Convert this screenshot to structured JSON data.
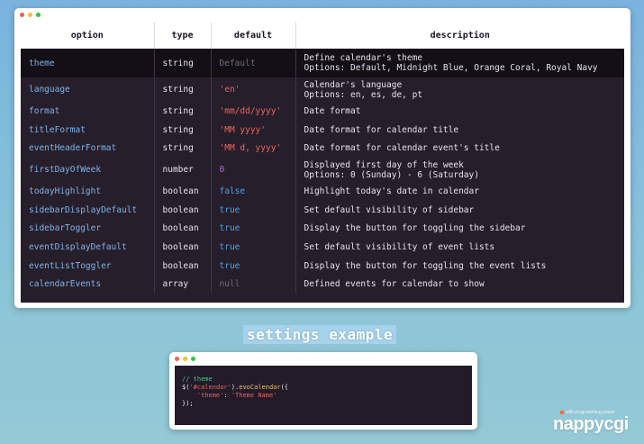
{
  "options_table": {
    "headers": [
      "option",
      "type",
      "default",
      "description"
    ],
    "rows": [
      {
        "option": "theme",
        "type": "string",
        "default": "Default",
        "default_kind": "default",
        "description": [
          "Define calendar's theme",
          "Options: Default, Midnight Blue, Orange Coral, Royal Navy"
        ]
      },
      {
        "option": "language",
        "type": "string",
        "default": "'en'",
        "default_kind": "string",
        "description": [
          "Calendar's language",
          "Options: en, es, de, pt"
        ]
      },
      {
        "option": "format",
        "type": "string",
        "default": "'mm/dd/yyyy'",
        "default_kind": "string",
        "description": [
          "Date format"
        ]
      },
      {
        "option": "titleFormat",
        "type": "string",
        "default": "'MM yyyy'",
        "default_kind": "string",
        "description": [
          "Date format for calendar title"
        ]
      },
      {
        "option": "eventHeaderFormat",
        "type": "string",
        "default": "'MM d, yyyy'",
        "default_kind": "string",
        "description": [
          "Date format for calendar event's title"
        ]
      },
      {
        "option": "firstDayOfWeek",
        "type": "number",
        "default": "0",
        "default_kind": "number",
        "description": [
          "Displayed first day of the week",
          "Options: 0 (Sunday) - 6 (Saturday)"
        ]
      },
      {
        "option": "todayHighlight",
        "type": "boolean",
        "default": "false",
        "default_kind": "bool",
        "description": [
          "Highlight today's date in calendar"
        ]
      },
      {
        "option": "sidebarDisplayDefault",
        "type": "boolean",
        "default": "true",
        "default_kind": "bool",
        "description": [
          "Set default visibility of sidebar"
        ]
      },
      {
        "option": "sidebarToggler",
        "type": "boolean",
        "default": "true",
        "default_kind": "bool",
        "description": [
          "Display the button for toggling the sidebar"
        ]
      },
      {
        "option": "eventDisplayDefault",
        "type": "boolean",
        "default": "true",
        "default_kind": "bool",
        "description": [
          "Set default visibility of event lists"
        ]
      },
      {
        "option": "eventListToggler",
        "type": "boolean",
        "default": "true",
        "default_kind": "bool",
        "description": [
          "Display the button for toggling the event lists"
        ]
      },
      {
        "option": "calendarEvents",
        "type": "array",
        "default": "null",
        "default_kind": "null",
        "description": [
          "Defined events for calendar to show"
        ]
      }
    ]
  },
  "caption": "settings example",
  "code_example": {
    "lines": [
      [
        {
          "t": "// theme",
          "k": "comment"
        }
      ],
      [
        {
          "t": "$(",
          "k": "plain"
        },
        {
          "t": "'#calendar'",
          "k": "string"
        },
        {
          "t": ").",
          "k": "plain"
        },
        {
          "t": "evoCalendar",
          "k": "fn"
        },
        {
          "t": "({",
          "k": "plain"
        }
      ],
      [
        {
          "t": "    ",
          "k": "plain"
        },
        {
          "t": "'theme'",
          "k": "string"
        },
        {
          "t": ": ",
          "k": "plain"
        },
        {
          "t": "'Theme Name'",
          "k": "string"
        }
      ],
      [
        {
          "t": "});",
          "k": "plain"
        }
      ]
    ]
  },
  "brand": {
    "tagline": "with programming power",
    "name": "nappycgi"
  },
  "colors": {
    "accent_blue": "#7fb3e6",
    "string_red": "#e8655a",
    "number_purple": "#a66be0",
    "bool_blue": "#4aa3e0"
  }
}
